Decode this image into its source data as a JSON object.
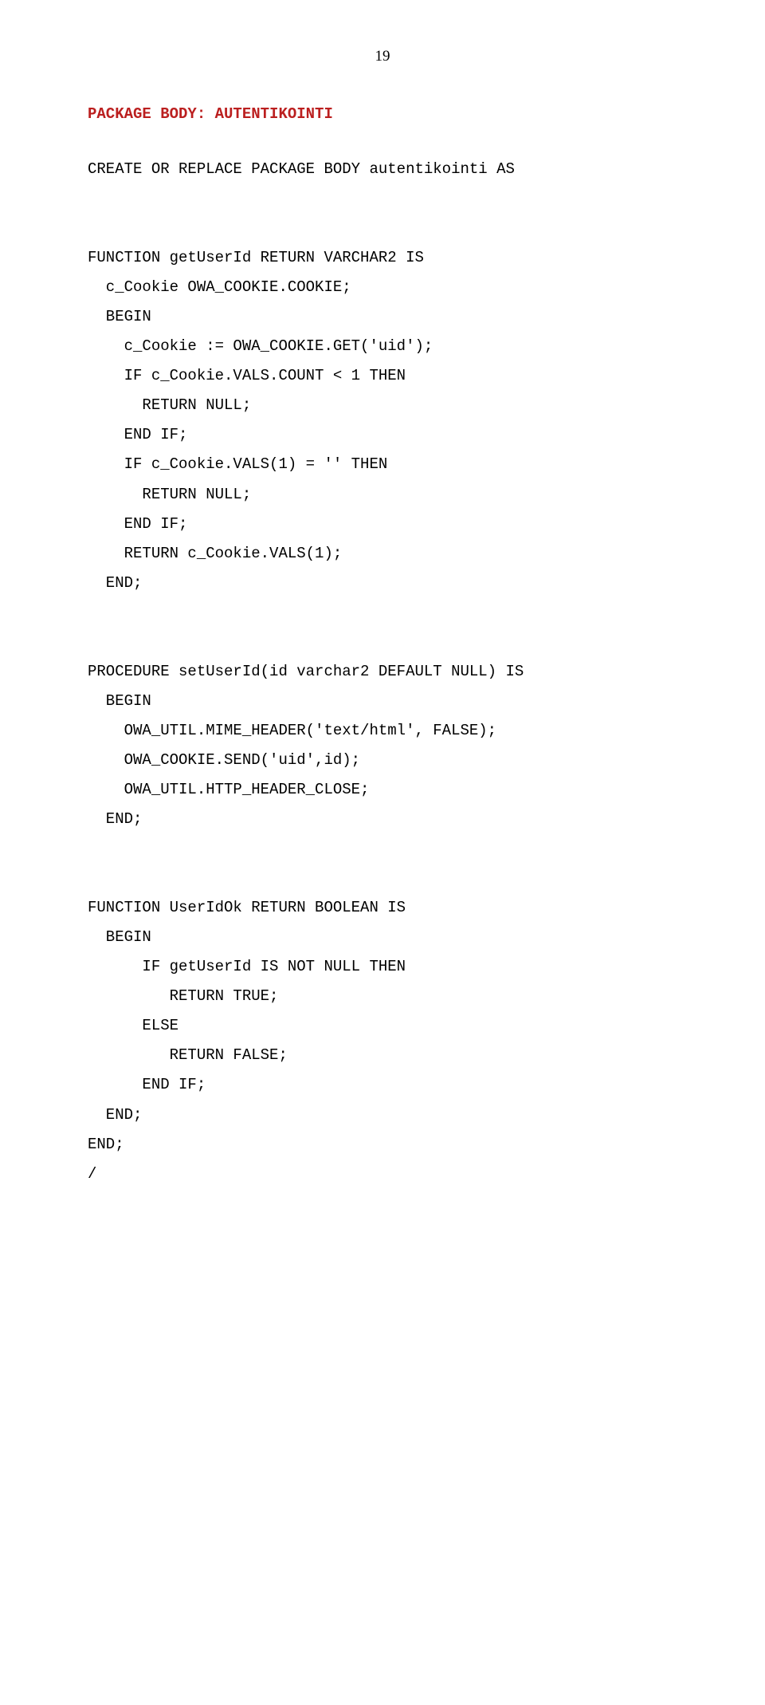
{
  "pageNumber": "19",
  "heading": "PACKAGE BODY: AUTENTIKOINTI",
  "codeLines": [
    "CREATE OR REPLACE PACKAGE BODY autentikointi AS",
    "",
    "",
    "FUNCTION getUserId RETURN VARCHAR2 IS",
    "  c_Cookie OWA_COOKIE.COOKIE;",
    "  BEGIN",
    "    c_Cookie := OWA_COOKIE.GET('uid');",
    "    IF c_Cookie.VALS.COUNT < 1 THEN",
    "      RETURN NULL;",
    "    END IF;",
    "    IF c_Cookie.VALS(1) = '' THEN",
    "      RETURN NULL;",
    "    END IF;",
    "    RETURN c_Cookie.VALS(1);",
    "  END;",
    "",
    "",
    "PROCEDURE setUserId(id varchar2 DEFAULT NULL) IS",
    "  BEGIN",
    "    OWA_UTIL.MIME_HEADER('text/html', FALSE);",
    "    OWA_COOKIE.SEND('uid',id);",
    "    OWA_UTIL.HTTP_HEADER_CLOSE;",
    "  END;",
    "",
    "",
    "FUNCTION UserIdOk RETURN BOOLEAN IS",
    "  BEGIN",
    "      IF getUserId IS NOT NULL THEN",
    "         RETURN TRUE;",
    "      ELSE",
    "         RETURN FALSE;",
    "      END IF;",
    "  END;",
    "END;",
    "/"
  ]
}
